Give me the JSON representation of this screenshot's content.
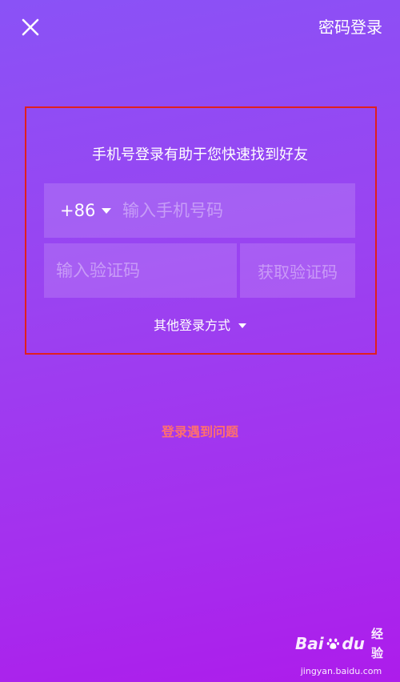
{
  "header": {
    "close_icon": "close-icon",
    "password_login_label": "密码登录"
  },
  "form": {
    "subtitle": "手机号登录有助于您快速找到好友",
    "country_code": "+86",
    "phone_placeholder": "输入手机号码",
    "phone_value": "",
    "code_placeholder": "输入验证码",
    "code_value": "",
    "get_code_label": "获取验证码",
    "other_methods_label": "其他登录方式",
    "highlight_color": "#e0201e"
  },
  "help": {
    "login_problem_label": "登录遇到问题",
    "color": "#ff6f6f"
  },
  "watermark": {
    "brand_left": "Bai",
    "brand_right": "du",
    "brand_suffix": "经验",
    "url": "jingyan.baidu.com",
    "paw_icon": "baidu-paw-icon"
  }
}
